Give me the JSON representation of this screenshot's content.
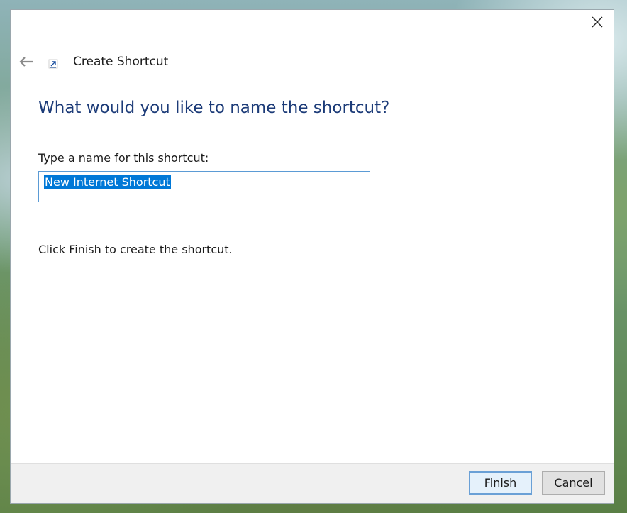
{
  "wizard": {
    "title": "Create Shortcut",
    "heading": "What would you like to name the shortcut?",
    "field_label": "Type a name for this shortcut:",
    "name_value": "New Internet Shortcut",
    "hint": "Click Finish to create the shortcut."
  },
  "buttons": {
    "finish": "Finish",
    "cancel": "Cancel"
  },
  "icons": {
    "close": "close-icon",
    "back": "back-arrow-icon",
    "wizard": "shortcut-icon"
  },
  "colors": {
    "heading": "#1c3b78",
    "accent": "#0078d7",
    "input_border": "#5b9bd5"
  }
}
